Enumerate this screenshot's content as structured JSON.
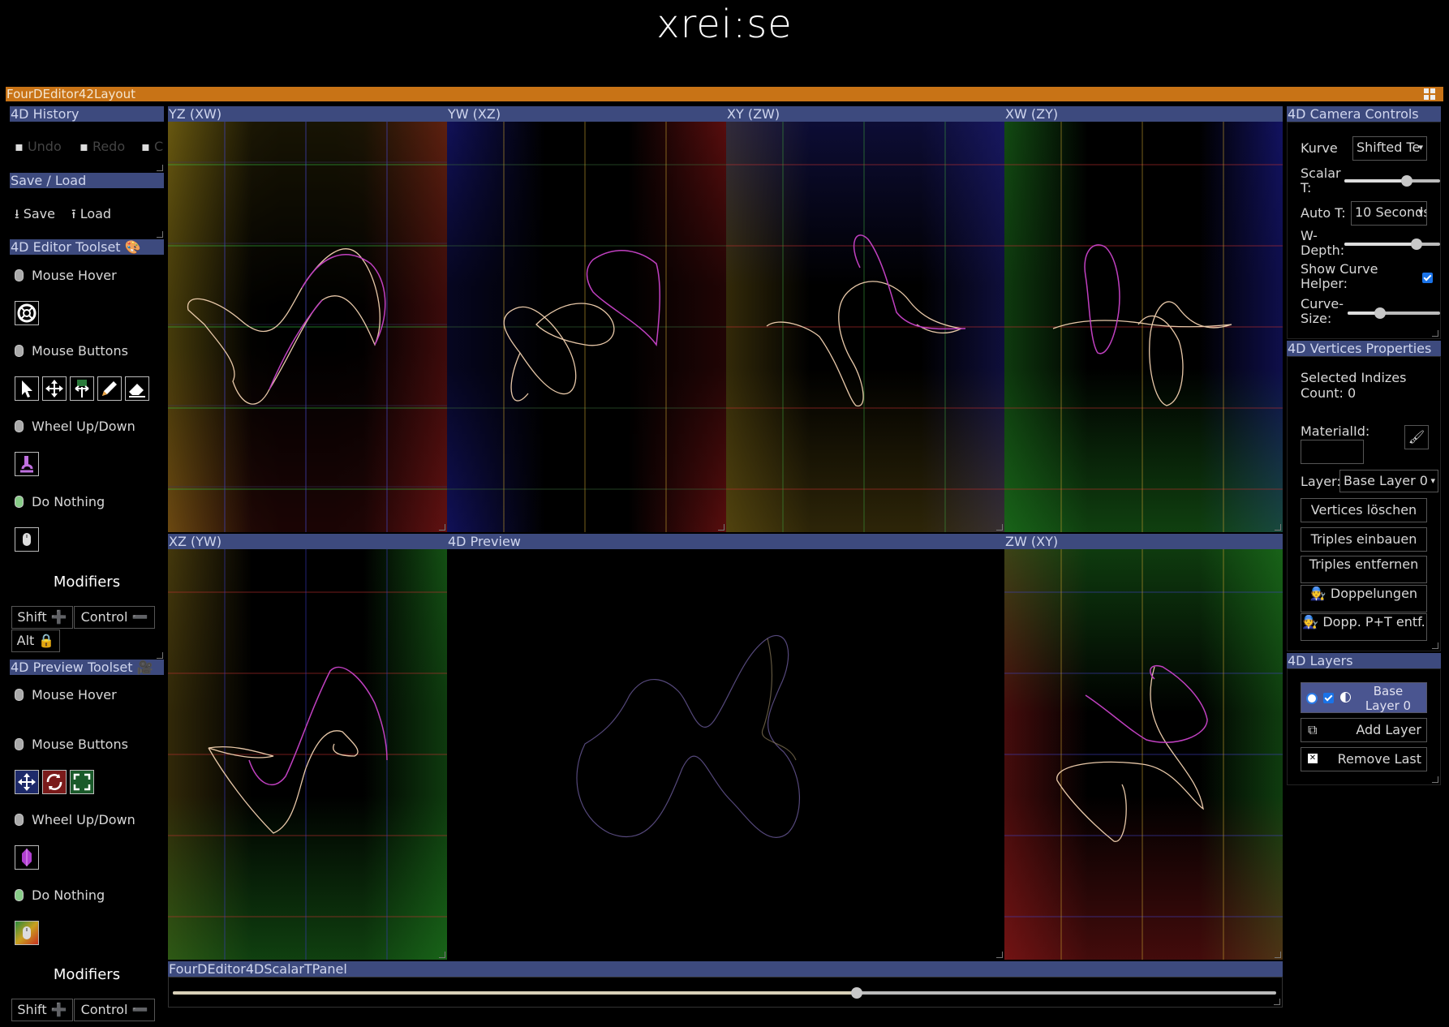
{
  "logo": "xrei:se",
  "layout_title": "FourDEditor42Layout",
  "left": {
    "history": {
      "title": "4D History",
      "undo": "Undo",
      "redo": "Redo",
      "extra": "C"
    },
    "saveload": {
      "title": "Save / Load",
      "save": "Save",
      "load": "Load"
    },
    "editor_toolset": {
      "title": "4D Editor Toolset 🎨",
      "mouse_hover": "Mouse Hover",
      "mouse_buttons": "Mouse Buttons",
      "wheel": "Wheel Up/Down",
      "do_nothing": "Do Nothing",
      "modifiers": "Modifiers",
      "shift": "Shift ➕",
      "control": "Control ➖",
      "alt": "Alt 🔒"
    },
    "preview_toolset": {
      "title": "4D Preview Toolset 🎥",
      "mouse_hover": "Mouse Hover",
      "mouse_buttons": "Mouse Buttons",
      "wheel": "Wheel Up/Down",
      "do_nothing": "Do Nothing",
      "modifiers": "Modifiers",
      "shift": "Shift ➕",
      "control": "Control ➖"
    }
  },
  "views": {
    "yz": "YZ (XW)",
    "yw": "YW (XZ)",
    "xy": "XY (ZW)",
    "xw": "XW (ZY)",
    "xz": "XZ (YW)",
    "preview": "4D Preview",
    "zw": "ZW (XY)"
  },
  "scalar_panel": {
    "title": "FourDEditor4DScalarTPanel",
    "value": 0.62
  },
  "right": {
    "camera": {
      "title": "4D Camera Controls",
      "kurve_label": "Kurve",
      "kurve_value": "Shifted Te",
      "scalar_label": "Scalar T:",
      "scalar_value": 0.65,
      "auto_label": "Auto T:",
      "auto_value": "10 Seconds",
      "wdepth_label": "W-Depth:",
      "wdepth_value": 0.75,
      "helper_label": "Show Curve Helper:",
      "curvesize_label": "Curve-Size:",
      "curvesize_value": 0.35
    },
    "vertices": {
      "title": "4D Vertices Properties",
      "selected": "Selected Indizes Count: 0",
      "material_label": "MaterialId:",
      "layer_label": "Layer:",
      "layer_value": "Base Layer 0",
      "btn_delete": "Vertices löschen",
      "btn_add_triples": "Triples einbauen",
      "btn_remove_triples": "Triples entfernen",
      "btn_dup": "🧑‍🔧 Doppelungen",
      "btn_dup_pt": "🧑‍🔧 Dopp. P+T entf."
    },
    "layers": {
      "title": "4D Layers",
      "base_layer": "Base Layer 0",
      "add": "Add Layer",
      "remove": "Remove Last"
    }
  },
  "colors": {
    "accent": "#c87316",
    "header": "#3d4a7e"
  }
}
